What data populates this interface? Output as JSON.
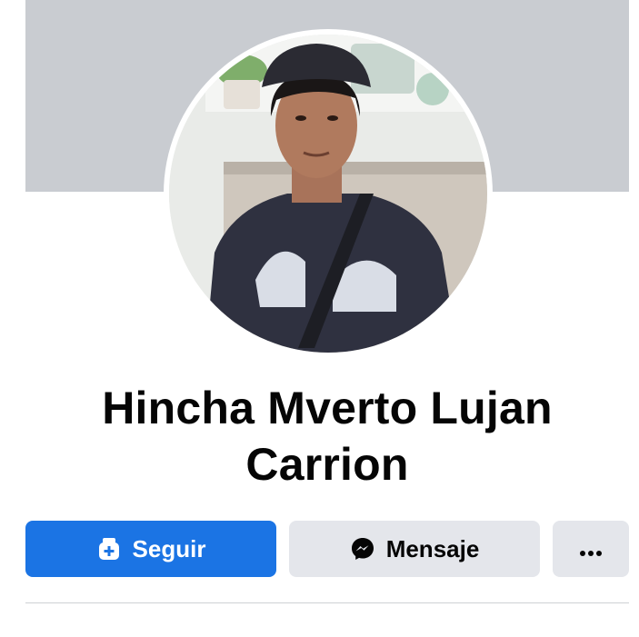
{
  "profile": {
    "name": "Hincha Mverto Lujan Carrion"
  },
  "actions": {
    "follow_label": "Seguir",
    "message_label": "Mensaje",
    "more_icon": "more-horizontal-icon"
  },
  "colors": {
    "cover": "#c9ccd1",
    "primary_button": "#1b74e4",
    "secondary_button": "#e4e6eb",
    "text": "#050505"
  }
}
